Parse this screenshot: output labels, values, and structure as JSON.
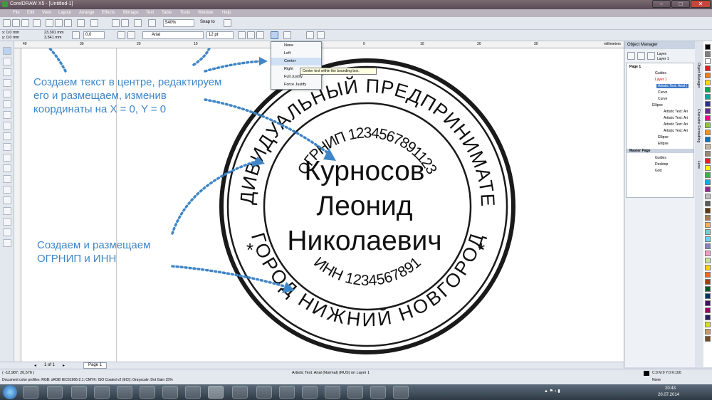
{
  "window": {
    "title": "CorelDRAW X5 - [Untitled-1]"
  },
  "menu": [
    "File",
    "Edit",
    "View",
    "Layout",
    "Arrange",
    "Effects",
    "Bitmaps",
    "Text",
    "Table",
    "Tools",
    "Window",
    "Help"
  ],
  "toolbar": {
    "zoom": "540%",
    "snap": "Snap to"
  },
  "props": {
    "x": "x: 0,0 mm",
    "y": "y: 0,0 mm",
    "w": "23,301 mm",
    "h": "3,541 mm",
    "angle": "0,0",
    "font": "Arial",
    "size": "12 pt"
  },
  "ruler": {
    "unit": "millimeters",
    "ticks": [
      "40",
      "30",
      "20",
      "10",
      "0",
      "10",
      "20",
      "30"
    ]
  },
  "align_menu": {
    "items": [
      "None",
      "Left",
      "Center",
      "Right",
      "Full Justify",
      "Force Justify"
    ],
    "tooltip": "Center text within the bounding box."
  },
  "stamp": {
    "outer_text": "ИНДИВИДУАЛЬНЫЙ ПРЕДПРИНИМАТЕЛЬ",
    "bottom_text": "ГОРОД НИЖНИЙ НОВГОРОД",
    "ogrnip": "ОГРНИП 1234567891123",
    "inn": "ИНН 1234567891",
    "name1": "Курносов",
    "name2": "Леонид",
    "name3": "Николаевич",
    "star": "*"
  },
  "annotations": {
    "a1": "Создаем текст в центре, редактируем",
    "a2": "его и размещаем, изменив",
    "a3": "координаты на X = 0, Y = 0",
    "b1": "Создаем и размещаем",
    "b2": "ОГРНИП и ИНН"
  },
  "docker": {
    "title": "Object Manager",
    "layer_label": "Layer:",
    "layer_value": "Layer 1",
    "tree": [
      "Page 1",
      "Guides",
      "Layer 1",
      "Artistic Text: Arial (",
      "Curve",
      "Curve",
      "Ellipse",
      "Artistic Text: Ari",
      "Artistic Text: Ari",
      "Artistic Text: Ari",
      "Artistic Text: Ari",
      "Ellipse",
      "Ellipse",
      "Master Page",
      "Guides",
      "Desktop",
      "Grid"
    ]
  },
  "docker_tabs": [
    "Object Manager",
    "Character Formatting",
    "Lens"
  ],
  "pagebar": {
    "counter": "1 of 1",
    "page": "Page 1"
  },
  "status": {
    "coords": "( -12,987; 20,576 )",
    "info": "Artistic Text: Arial (Normal) (RUS) on Layer 1",
    "profile": "Document color profiles: RGB: sRGB IEC61966-2.1; CMYK: ISO Coated v2 (ECI); Grayscale: Dot Gain 15%",
    "fill": "C:0 M:0 Y:0 K:100",
    "outline": "None"
  },
  "clock": {
    "time": "20:43",
    "date": "20.07.2014"
  },
  "colors": {
    "accent": "#3f86c7",
    "palette": [
      "#000000",
      "#7f7f7f",
      "#ffffff",
      "#e31e24",
      "#ef7f1a",
      "#ffdd00",
      "#00a651",
      "#00a99d",
      "#2e3192",
      "#662d91",
      "#ec008c",
      "#8dc63f",
      "#f7941d",
      "#0072bc",
      "#c2b59b",
      "#998675",
      "#ed1c24",
      "#fff200",
      "#39b54a",
      "#00aeef",
      "#92278f",
      "#bcbec0",
      "#58595b",
      "#603913",
      "#a67c52",
      "#fbaf5d",
      "#7accc8",
      "#6dcff6",
      "#8781bd",
      "#f49ac2",
      "#c4df9b",
      "#ffd200",
      "#f26522",
      "#a0410d",
      "#005826",
      "#003663",
      "#440e62",
      "#9e005d",
      "#262262",
      "#d7df23",
      "#c69c6d",
      "#754c24"
    ]
  }
}
